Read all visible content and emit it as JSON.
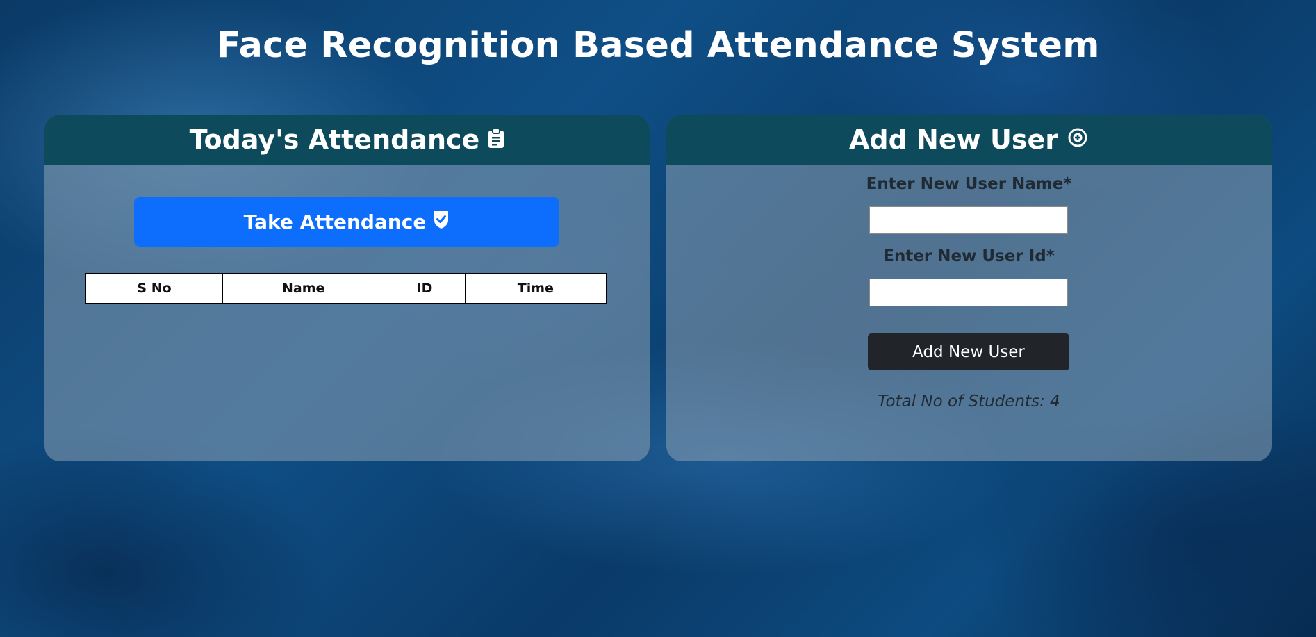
{
  "page": {
    "title": "Face Recognition Based Attendance System"
  },
  "attendance": {
    "header": "Today's Attendance",
    "header_icon": "clipboard-icon",
    "take_button": "Take Attendance",
    "take_button_icon": "shield-check-icon",
    "columns": [
      "S No",
      "Name",
      "ID",
      "Time"
    ],
    "rows": []
  },
  "add_user": {
    "header": "Add New User",
    "header_icon": "plus-circle-icon",
    "name_label": "Enter New User Name*",
    "name_value": "",
    "id_label": "Enter New User Id*",
    "id_value": "",
    "submit_label": "Add New User",
    "total_text": "Total No of Students: 4"
  },
  "colors": {
    "panel_header": "#0c4a5c",
    "primary_button": "#0d6efd",
    "dark_button": "#212529",
    "title_text": "#ffffff"
  }
}
